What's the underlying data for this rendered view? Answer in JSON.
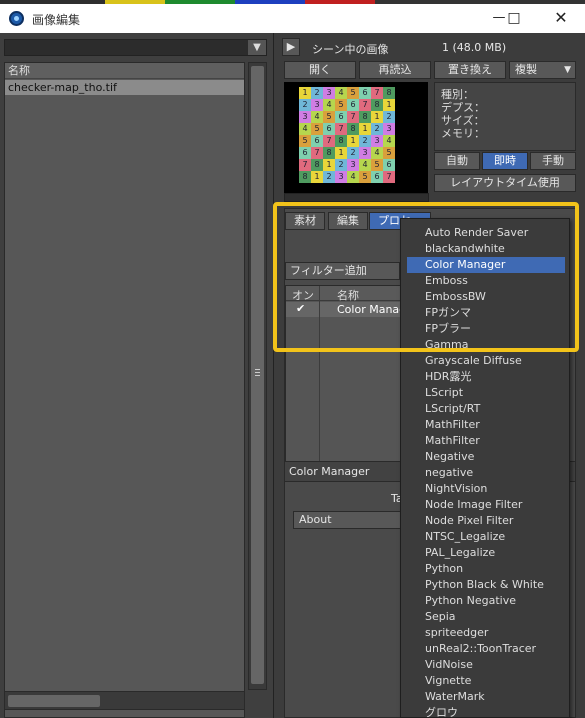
{
  "window": {
    "title": "画像編集",
    "minimize_icon": "minimize-icon",
    "maximize_icon": "maximize-icon",
    "close_icon": "close-icon"
  },
  "colors": {
    "accent": "#3f6ab4",
    "highlight": "#f2c31a",
    "panel": "#4a4a4a",
    "list_selected": "#8b8b8b"
  },
  "left_panel": {
    "list_header": "名称",
    "images": [
      "checker-map_tho.tif"
    ]
  },
  "right_panel": {
    "scene_label": "シーン中の画像",
    "scene_count": "1 (48.0 MB)",
    "buttons": {
      "open": "開く",
      "reload": "再読込",
      "replace": "置き換え",
      "clone": "複製"
    },
    "info": {
      "type": "種別：",
      "depth": "デプス：",
      "size": "サイズ：",
      "memory": "メモリ："
    },
    "modes": {
      "auto": "自動",
      "immediate": "即時",
      "manual": "手動"
    },
    "layout_time": "レイアウトタイム使用",
    "tabs": {
      "material": "素材",
      "edit": "編集",
      "processing": "プロセ"
    },
    "filter_add": "フィルター追加",
    "filter_columns": {
      "on": "オン",
      "name": "名称"
    },
    "filters": [
      {
        "on": "✔",
        "name": "Color Manag"
      }
    ],
    "color_manager": {
      "title": "Color Manager",
      "about": "About",
      "ta": "Ta"
    }
  },
  "preview_grid": [
    [
      "1",
      "2",
      "3",
      "4",
      "5",
      "6",
      "7",
      "8"
    ],
    [
      "2",
      "3",
      "4",
      "5",
      "6",
      "7",
      "8",
      "1"
    ],
    [
      "3",
      "4",
      "5",
      "6",
      "7",
      "8",
      "1",
      "2"
    ],
    [
      "4",
      "5",
      "6",
      "7",
      "8",
      "1",
      "2",
      "3"
    ],
    [
      "5",
      "6",
      "7",
      "8",
      "1",
      "2",
      "3",
      "4"
    ],
    [
      "6",
      "7",
      "8",
      "1",
      "2",
      "3",
      "4",
      "5"
    ],
    [
      "7",
      "8",
      "1",
      "2",
      "3",
      "4",
      "5",
      "6"
    ],
    [
      "8",
      "1",
      "2",
      "3",
      "4",
      "5",
      "6",
      "7"
    ]
  ],
  "dropdown_menu": {
    "selected": "Color Manager",
    "items": [
      "Auto Render Saver",
      "blackandwhite",
      "Color Manager",
      "Emboss",
      "EmbossBW",
      "FPガンマ",
      "FPブラー",
      "Gamma",
      "Grayscale Diffuse",
      "HDR露光",
      "LScript",
      "LScript/RT",
      "MathFilter",
      "MathFilter",
      "Negative",
      "negative",
      "NightVision",
      "Node Image Filter",
      "Node Pixel Filter",
      "NTSC_Legalize",
      "PAL_Legalize",
      "Python",
      "Python Black & White",
      "Python Negative",
      "Sepia",
      "spriteedger",
      "unReal2::ToonTracer",
      "VidNoise",
      "Vignette",
      "WaterMark",
      "グロウ"
    ]
  }
}
